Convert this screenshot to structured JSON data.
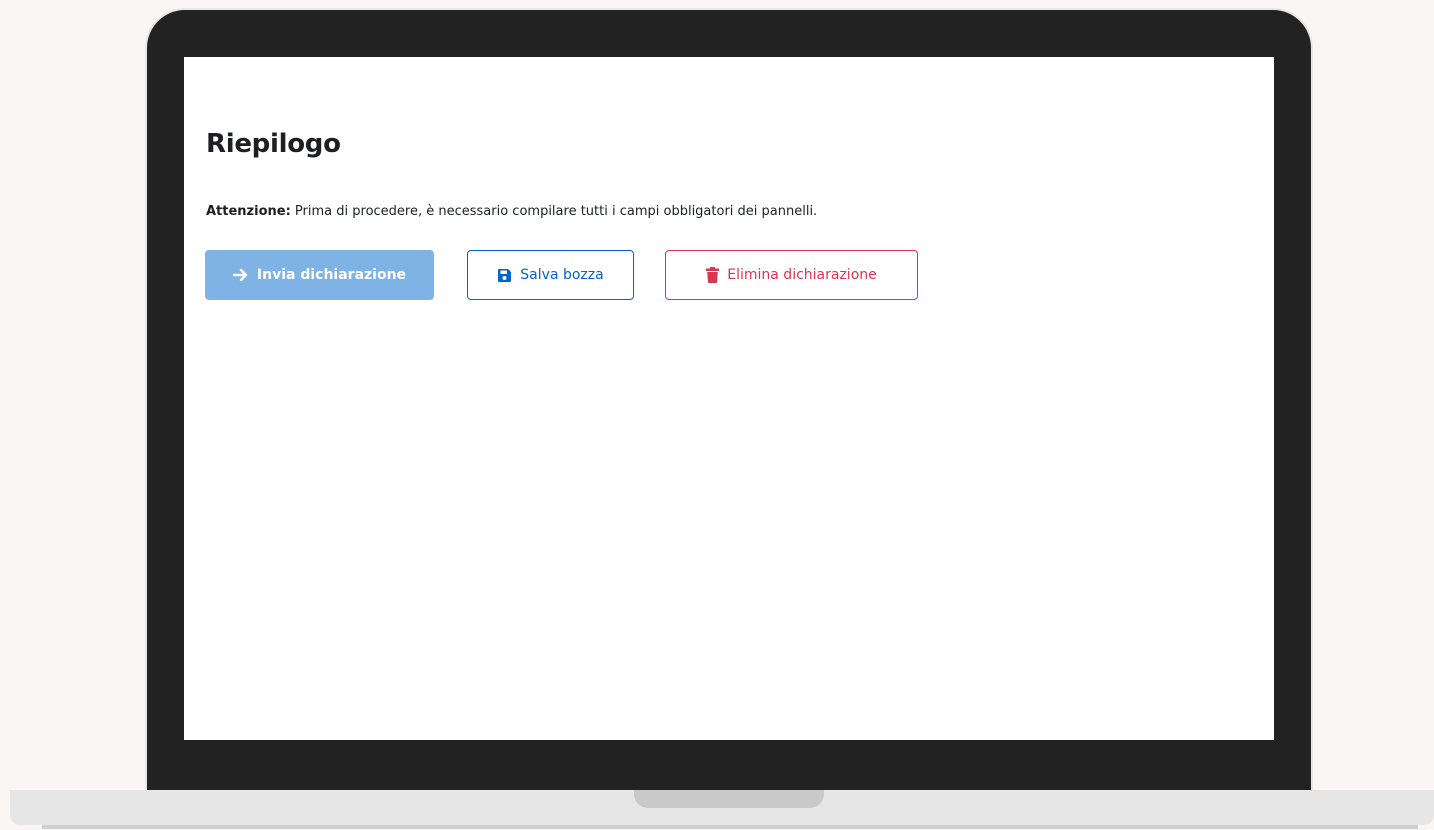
{
  "page": {
    "title": "Riepilogo",
    "notice_label": "Attenzione:",
    "notice_text": " Prima di procedere, è necessario compilare tutti i campi obbligatori dei pannelli."
  },
  "actions": {
    "submit": {
      "label": "Invia dichiarazione",
      "icon": "arrow-right-icon",
      "disabled": true,
      "color": "#7fb3e6"
    },
    "save": {
      "label": "Salva bozza",
      "icon": "floppy-disk-icon",
      "color": "#0066cc"
    },
    "delete": {
      "label": "Elimina dichiarazione",
      "icon": "trash-icon",
      "color": "#d9364f"
    }
  },
  "colors": {
    "frame": "#222222",
    "screen": "#ffffff",
    "background": "#f8f7f5"
  }
}
